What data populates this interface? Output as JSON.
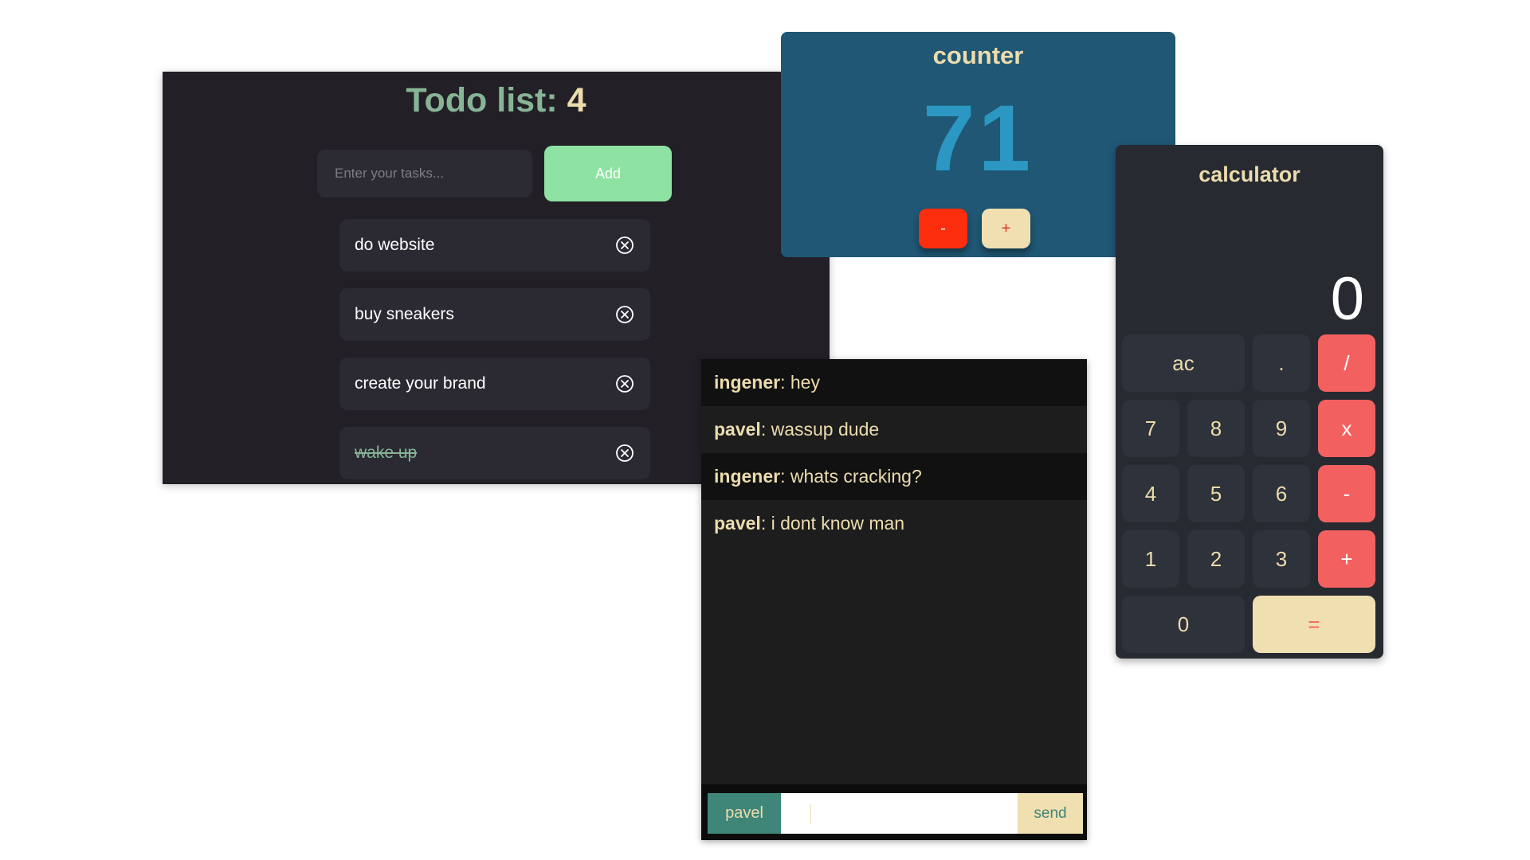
{
  "todo": {
    "title_prefix": "Todo list: ",
    "count": "4",
    "input_placeholder": "Enter your tasks...",
    "add_label": "Add",
    "items": [
      {
        "text": "do website",
        "done": false
      },
      {
        "text": "buy sneakers",
        "done": false
      },
      {
        "text": "create your brand",
        "done": false
      },
      {
        "text": "wake up",
        "done": true
      }
    ]
  },
  "counter": {
    "title": "counter",
    "value": "71",
    "minus_label": "-",
    "plus_label": "+"
  },
  "chat": {
    "messages": [
      {
        "name": "ingener",
        "text": ": hey"
      },
      {
        "name": "pavel",
        "text": ": wassup dude"
      },
      {
        "name": "ingener",
        "text": ": whats cracking?"
      },
      {
        "name": "pavel",
        "text": ": i dont know man"
      }
    ],
    "current_user": "pavel",
    "input_value": "",
    "send_label": "send"
  },
  "calculator": {
    "title": "calculator",
    "display": "0",
    "keys": {
      "ac": "ac",
      "dot": ".",
      "divide": "/",
      "seven": "7",
      "eight": "8",
      "nine": "9",
      "multiply": "x",
      "four": "4",
      "five": "5",
      "six": "6",
      "subtract": "-",
      "one": "1",
      "two": "2",
      "three": "3",
      "add": "+",
      "zero": "0",
      "equals": "="
    }
  },
  "colors": {
    "todo_bg": "#221f26",
    "todo_accent": "#8ee2a2",
    "counter_bg": "#1f5774",
    "counter_value": "#2b97c2",
    "calc_bg": "#272a31",
    "calc_operator": "#f26160",
    "cream": "#ecdcae"
  }
}
